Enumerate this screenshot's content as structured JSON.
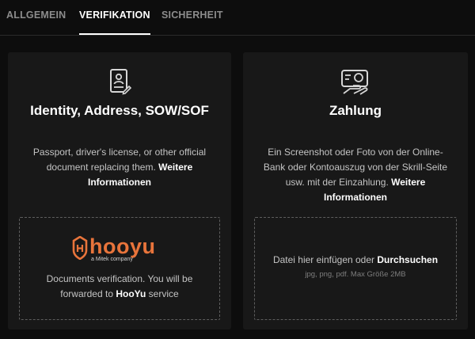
{
  "tabs": [
    {
      "label": "ALLGEMEIN",
      "active": false
    },
    {
      "label": "VERIFIKATION",
      "active": true
    },
    {
      "label": "SICHERHEIT",
      "active": false
    }
  ],
  "identity_card": {
    "icon": "id-document-icon",
    "title": "Identity, Address, SOW/SOF",
    "description": "Passport, driver's license, or other official document replacing them.",
    "more_link": "Weitere Informationen",
    "provider_logo": "hooyu",
    "provider_tagline": "a Mitek company",
    "provider_text_before": "Documents verification. You will be forwarded to ",
    "provider_name": "HooYu",
    "provider_text_after": " service"
  },
  "payment_card": {
    "icon": "payment-card-icon",
    "title": "Zahlung",
    "description": "Ein Screenshot oder Foto von der Online-Bank oder Kontoauszug von der Skrill-Seite usw. mit der Einzahlung.",
    "more_link": "Weitere Informationen",
    "upload_text": "Datei hier einfügen oder ",
    "browse_label": "Durchsuchen",
    "upload_hint": "jpg, png, pdf. Max Größe 2MB"
  },
  "colors": {
    "background": "#0d0d0d",
    "card": "#181818",
    "accent": "#e8743b",
    "text_active": "#ffffff",
    "text_muted": "#8c8c8c"
  }
}
